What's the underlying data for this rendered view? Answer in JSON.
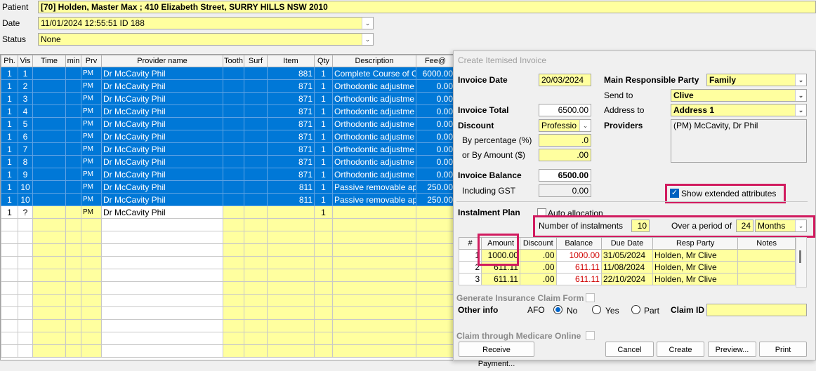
{
  "header": {
    "patient_label": "Patient",
    "patient_value": "[70] Holden, Master Max ; 410 Elizabeth Street, SURRY HILLS NSW 2010",
    "date_label": "Date",
    "date_value": "11/01/2024 12:55:51  ID 188",
    "status_label": "Status",
    "status_value": "None"
  },
  "grid": {
    "columns": [
      "Ph.",
      "Vis",
      "Time",
      "min",
      "Prv",
      "Provider name",
      "Tooth",
      "Surf",
      "Item",
      "Qty",
      "Description",
      "Fee@"
    ],
    "rows": [
      {
        "ph": "1",
        "vis": "1",
        "prv": "PM",
        "provider": "Dr McCavity Phil",
        "item": "881",
        "qty": "1",
        "desc": "Complete Course of O",
        "fee": "6000.00"
      },
      {
        "ph": "1",
        "vis": "2",
        "prv": "PM",
        "provider": "Dr McCavity Phil",
        "item": "871",
        "qty": "1",
        "desc": "Orthodontic adjustme",
        "fee": "0.00"
      },
      {
        "ph": "1",
        "vis": "3",
        "prv": "PM",
        "provider": "Dr McCavity Phil",
        "item": "871",
        "qty": "1",
        "desc": "Orthodontic adjustme",
        "fee": "0.00"
      },
      {
        "ph": "1",
        "vis": "4",
        "prv": "PM",
        "provider": "Dr McCavity Phil",
        "item": "871",
        "qty": "1",
        "desc": "Orthodontic adjustme",
        "fee": "0.00"
      },
      {
        "ph": "1",
        "vis": "5",
        "prv": "PM",
        "provider": "Dr McCavity Phil",
        "item": "871",
        "qty": "1",
        "desc": "Orthodontic adjustme",
        "fee": "0.00"
      },
      {
        "ph": "1",
        "vis": "6",
        "prv": "PM",
        "provider": "Dr McCavity Phil",
        "item": "871",
        "qty": "1",
        "desc": "Orthodontic adjustme",
        "fee": "0.00"
      },
      {
        "ph": "1",
        "vis": "7",
        "prv": "PM",
        "provider": "Dr McCavity Phil",
        "item": "871",
        "qty": "1",
        "desc": "Orthodontic adjustme",
        "fee": "0.00"
      },
      {
        "ph": "1",
        "vis": "8",
        "prv": "PM",
        "provider": "Dr McCavity Phil",
        "item": "871",
        "qty": "1",
        "desc": "Orthodontic adjustme",
        "fee": "0.00"
      },
      {
        "ph": "1",
        "vis": "9",
        "prv": "PM",
        "provider": "Dr McCavity Phil",
        "item": "871",
        "qty": "1",
        "desc": "Orthodontic adjustme",
        "fee": "0.00"
      },
      {
        "ph": "1",
        "vis": "10",
        "prv": "PM",
        "provider": "Dr McCavity Phil",
        "item": "811",
        "qty": "1",
        "desc": "Passive removable ap",
        "fee": "250.00"
      },
      {
        "ph": "1",
        "vis": "10",
        "prv": "PM",
        "provider": "Dr McCavity Phil",
        "item": "811",
        "qty": "1",
        "desc": "Passive removable ap",
        "fee": "250.00"
      }
    ],
    "new_row": {
      "ph": "1",
      "vis": "?",
      "prv": "PM",
      "provider": "Dr McCavity Phil",
      "qty": "1"
    }
  },
  "dialog": {
    "title": "Create Itemised Invoice",
    "invoice_date_label": "Invoice Date",
    "invoice_date": "20/03/2024",
    "invoice_total_label": "Invoice Total",
    "invoice_total": "6500.00",
    "discount_label": "Discount",
    "discount_value": "Professio",
    "by_percentage_label": "By percentage (%)",
    "by_percentage": ".0",
    "by_amount_label": "or  By Amount ($)",
    "by_amount": ".00",
    "invoice_balance_label": "Invoice Balance",
    "invoice_balance": "6500.00",
    "including_gst_label": "Including GST",
    "including_gst": "0.00",
    "main_party_label": "Main Responsible Party",
    "main_party": "Family",
    "send_to_label": "Send to",
    "send_to": "Clive",
    "address_to_label": "Address to",
    "address_to": "Address 1",
    "providers_label": "Providers",
    "providers_value": "(PM) McCavity, Dr Phil",
    "show_extended_label": "Show extended attributes",
    "instalment_plan_label": "Instalment Plan",
    "auto_allocation_label": "Auto allocation",
    "num_instalments_label": "Number of instalments",
    "num_instalments": "10",
    "period_label": "Over a period of",
    "period_value": "24",
    "period_unit": "Months",
    "instalments": {
      "columns": [
        "#",
        "Amount",
        "Discount",
        "Balance",
        "Due Date",
        "Resp Party",
        "Notes"
      ],
      "rows": [
        {
          "n": "1",
          "amount": "1000.00",
          "discount": ".00",
          "balance": "1000.00",
          "due": "31/05/2024",
          "party": "Holden, Mr Clive",
          "notes": ""
        },
        {
          "n": "2",
          "amount": "611.11",
          "discount": ".00",
          "balance": "611.11",
          "due": "11/08/2024",
          "party": "Holden, Mr Clive",
          "notes": ""
        },
        {
          "n": "3",
          "amount": "611.11",
          "discount": ".00",
          "balance": "611.11",
          "due": "22/10/2024",
          "party": "Holden, Mr Clive",
          "notes": ""
        }
      ]
    },
    "gen_insurance_label": "Generate Insurance Claim Form",
    "other_info_label": "Other info",
    "afo_label": "AFO",
    "afo_no": "No",
    "afo_yes": "Yes",
    "afo_part": "Part",
    "claim_id_label": "Claim ID",
    "medicare_label": "Claim through Medicare Online",
    "buttons": {
      "receive_payment": "Receive  Payment...",
      "cancel": "Cancel",
      "create": "Create",
      "preview": "Preview...",
      "print": "Print"
    },
    "highlight_color": "#d11b5f"
  }
}
